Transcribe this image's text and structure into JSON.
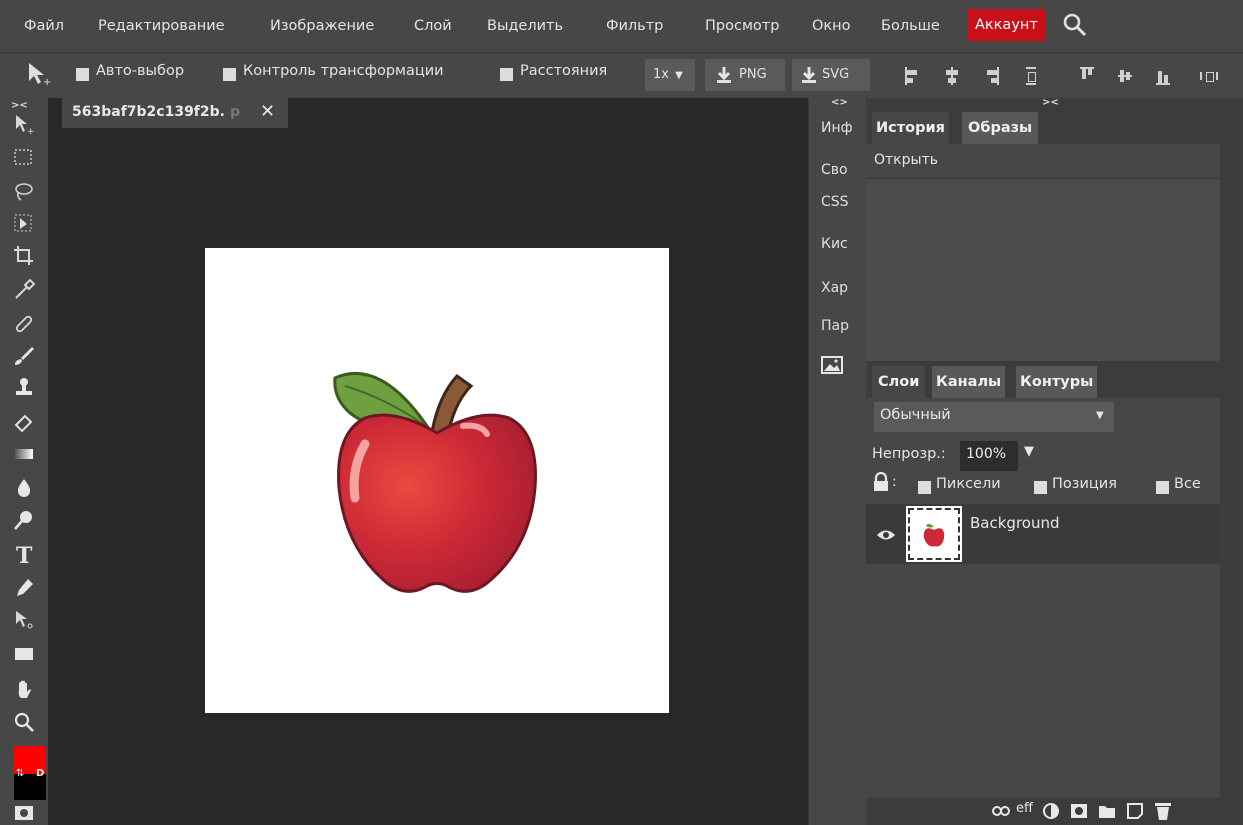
{
  "menu": {
    "items": [
      "Файл",
      "Редактирование",
      "Изображение",
      "Слой",
      "Выделить",
      "Фильтр",
      "Просмотр",
      "Окно",
      "Больше"
    ],
    "account": "Аккаунт"
  },
  "options": {
    "autoselect": "Авто-выбор",
    "transform": "Контроль трансформации",
    "distances": "Расстояния",
    "zoom": "1x",
    "png": "PNG",
    "svg": "SVG"
  },
  "document": {
    "tab_name": "563baf7b2c139f2b.",
    "tab_ext": "p"
  },
  "side_items": [
    "Инф",
    "Сво",
    "CSS",
    "Кис",
    "Хар",
    "Пар"
  ],
  "history_panel": {
    "tabs": [
      "История",
      "Образы"
    ],
    "entries": [
      "Открыть"
    ]
  },
  "layers_panel": {
    "tabs": [
      "Слои",
      "Каналы",
      "Контуры"
    ],
    "blend_mode": "Обычный",
    "opacity_label": "Непрозр.:",
    "opacity_value": "100%",
    "lock_pixels": "Пиксели",
    "lock_position": "Позиция",
    "lock_all": "Все",
    "layers": [
      {
        "name": "Background"
      }
    ],
    "footer": [
      "eff"
    ]
  },
  "colors": {
    "accent_red": "#c9101a",
    "foreground": "#ff0000",
    "background": "#000000"
  }
}
